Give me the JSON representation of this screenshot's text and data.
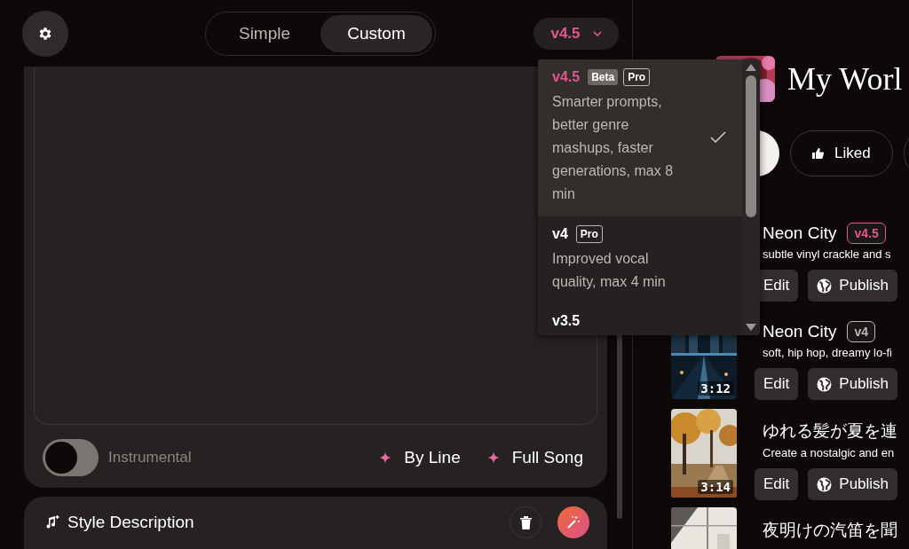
{
  "mode_tabs": [
    {
      "label": "Simple",
      "selected": false
    },
    {
      "label": "Custom",
      "selected": true
    }
  ],
  "model_select": {
    "value": "v4.5",
    "expanded": true
  },
  "lyrics": {
    "instrumental": {
      "label": "Instrumental",
      "on": false
    },
    "actions": [
      "By Line",
      "Full Song"
    ]
  },
  "style_section": {
    "title": "Style Description"
  },
  "workspace": {
    "title": "My Worl",
    "actions": [
      {
        "label": "Liked"
      }
    ]
  },
  "songs": [
    {
      "title": "Neon City",
      "version": {
        "label": "v4.5",
        "color": "#e0578f"
      },
      "description": "subtle vinyl crackle and s",
      "buttons": [
        "Edit",
        "Publish"
      ]
    },
    {
      "title": "Neon City",
      "version": {
        "label": "v4",
        "color": "#bdb8b5"
      },
      "description": "soft, hip hop, dreamy lo-fi",
      "duration": "3:12",
      "kind": "picture",
      "buttons": [
        "Edit",
        "Publish"
      ]
    },
    {
      "title": "ゆれる髪が夏を連",
      "description": "Create a nostalgic and en",
      "duration": "3:14",
      "kind": "picture",
      "buttons": [
        "Edit",
        "Publish"
      ]
    },
    {
      "title": "夜明けの汽笛を聞",
      "kind": "picture"
    }
  ],
  "model_menu": {
    "items": [
      {
        "name": "v4.5",
        "badges": [
          {
            "label": "Beta",
            "kind": "filled"
          },
          {
            "label": "Pro",
            "kind": "outline"
          }
        ],
        "description": "Smarter prompts, better genre mashups, faster generations, max 8 min",
        "selected": true
      },
      {
        "name": "v4",
        "badges": [
          {
            "label": "Pro",
            "kind": "outline"
          }
        ],
        "description": "Improved vocal quality, max 4 min",
        "selected": false
      },
      {
        "name": "v3.5",
        "selected": false
      }
    ]
  }
}
